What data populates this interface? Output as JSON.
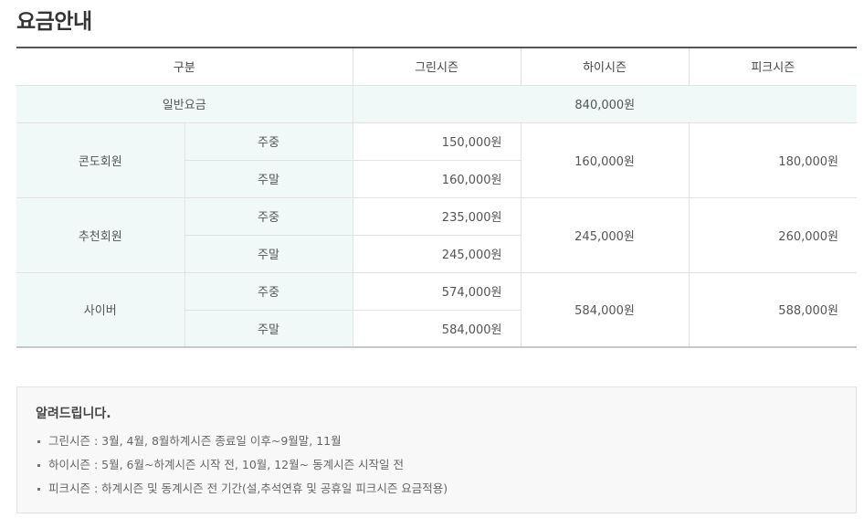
{
  "title": "요금안내",
  "table": {
    "headers": {
      "category": "구분",
      "green": "그린시즌",
      "high": "하이시즌",
      "peak": "피크시즌"
    },
    "general": {
      "label": "일반요금",
      "price": "840,000원"
    },
    "groups": [
      {
        "name": "콘도회원",
        "weekday_label": "주중",
        "weekday_green": "150,000원",
        "weekend_label": "주말",
        "weekend_green": "160,000원",
        "high": "160,000원",
        "peak": "180,000원"
      },
      {
        "name": "추천회원",
        "weekday_label": "주중",
        "weekday_green": "235,000원",
        "weekend_label": "주말",
        "weekend_green": "245,000원",
        "high": "245,000원",
        "peak": "260,000원"
      },
      {
        "name": "사이버",
        "weekday_label": "주중",
        "weekday_green": "574,000원",
        "weekend_label": "주말",
        "weekend_green": "584,000원",
        "high": "584,000원",
        "peak": "588,000원"
      }
    ]
  },
  "notice": {
    "title": "알려드립니다.",
    "items": [
      "그린시즌 : 3월, 4월, 8월하계시즌 종료일 이후~9월말, 11월",
      "하이시즌 : 5월, 6월~하계시즌 시작 전, 10월, 12월~ 동계시즌 시작일 전",
      "피크시즌 : 하계시즌 및 동계시즌 전 기간(설,추석연휴 및 공휴일 피크시즌 요금적용)"
    ]
  }
}
